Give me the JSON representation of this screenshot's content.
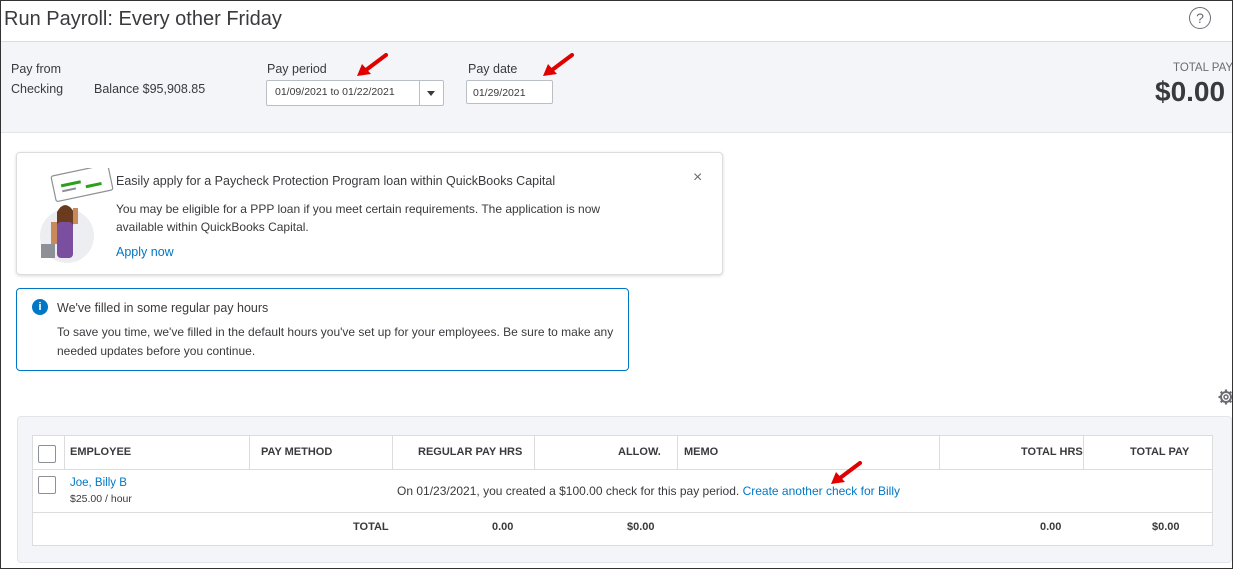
{
  "title": "Run Payroll: Every other Friday",
  "help_icon": "?",
  "pay_from": {
    "label": "Pay from",
    "account": "Checking",
    "balance": "Balance $95,908.85"
  },
  "pay_period": {
    "label": "Pay period",
    "value": "01/09/2021 to 01/22/2021"
  },
  "pay_date": {
    "label": "Pay date",
    "value": "01/29/2021"
  },
  "total_pay": {
    "label": "TOTAL PAY",
    "value": "$0.00"
  },
  "promo": {
    "title": "Easily apply for a Paycheck Protection Program loan within QuickBooks Capital",
    "body": "You may be eligible for a PPP loan if you meet certain requirements. The application is now available within QuickBooks Capital.",
    "link": "Apply now",
    "close": "×"
  },
  "info": {
    "icon": "i",
    "title": "We've filled in some regular pay hours",
    "body": "To save you time, we've filled in the default hours you've set up for your employees. Be sure to make any needed updates before you continue."
  },
  "table": {
    "headers": [
      "EMPLOYEE",
      "PAY METHOD",
      "REGULAR PAY HRS",
      "ALLOW.",
      "MEMO",
      "TOTAL HRS",
      "TOTAL PAY"
    ],
    "employee": {
      "name": "Joe, Billy B",
      "rate": "$25.00 / hour"
    },
    "message": "On 01/23/2021, you created a $100.00 check for this pay period.",
    "message_link": "Create another check for Billy",
    "totals": {
      "label": "TOTAL",
      "regular_hrs": "0.00",
      "allow": "$0.00",
      "total_hrs": "0.00",
      "total_pay": "$0.00"
    }
  },
  "colors": {
    "accent": "#0077c5",
    "arrow": "#e00000",
    "header_bg": "#f4f5f8"
  }
}
